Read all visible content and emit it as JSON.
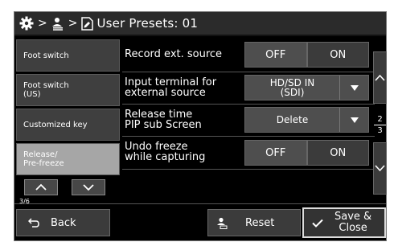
{
  "header": {
    "title": "User Presets: 01",
    "separator": ">"
  },
  "sidebar": {
    "items": [
      {
        "label": "Foot switch"
      },
      {
        "label": "Foot switch\n(US)"
      },
      {
        "label": "Customized key"
      },
      {
        "label": "Release/\nPre-freeze",
        "active": true
      }
    ],
    "page_count": "3/6"
  },
  "rows": [
    {
      "label": "Record ext. source",
      "type": "toggle",
      "off": "OFF",
      "on": "ON",
      "value": "OFF"
    },
    {
      "label": "Input terminal for\nexternal source",
      "type": "dropdown",
      "value": "HD/SD IN\n(SDI)"
    },
    {
      "label": "Release time\nPIP sub Screen",
      "type": "dropdown",
      "value": "Delete"
    },
    {
      "label": "Undo freeze\nwhile capturing",
      "type": "toggle",
      "off": "OFF",
      "on": "ON",
      "value": "OFF"
    }
  ],
  "pager": {
    "current": "2",
    "total": "3"
  },
  "footer": {
    "back": "Back",
    "reset": "Reset",
    "save": "Save &\nClose"
  },
  "colors": {
    "background": "#000000",
    "header": "#2b2b2b",
    "button": "#3b3b3b",
    "selected": "#4e4e4e",
    "active_sidebar": "#a6a6a6"
  }
}
